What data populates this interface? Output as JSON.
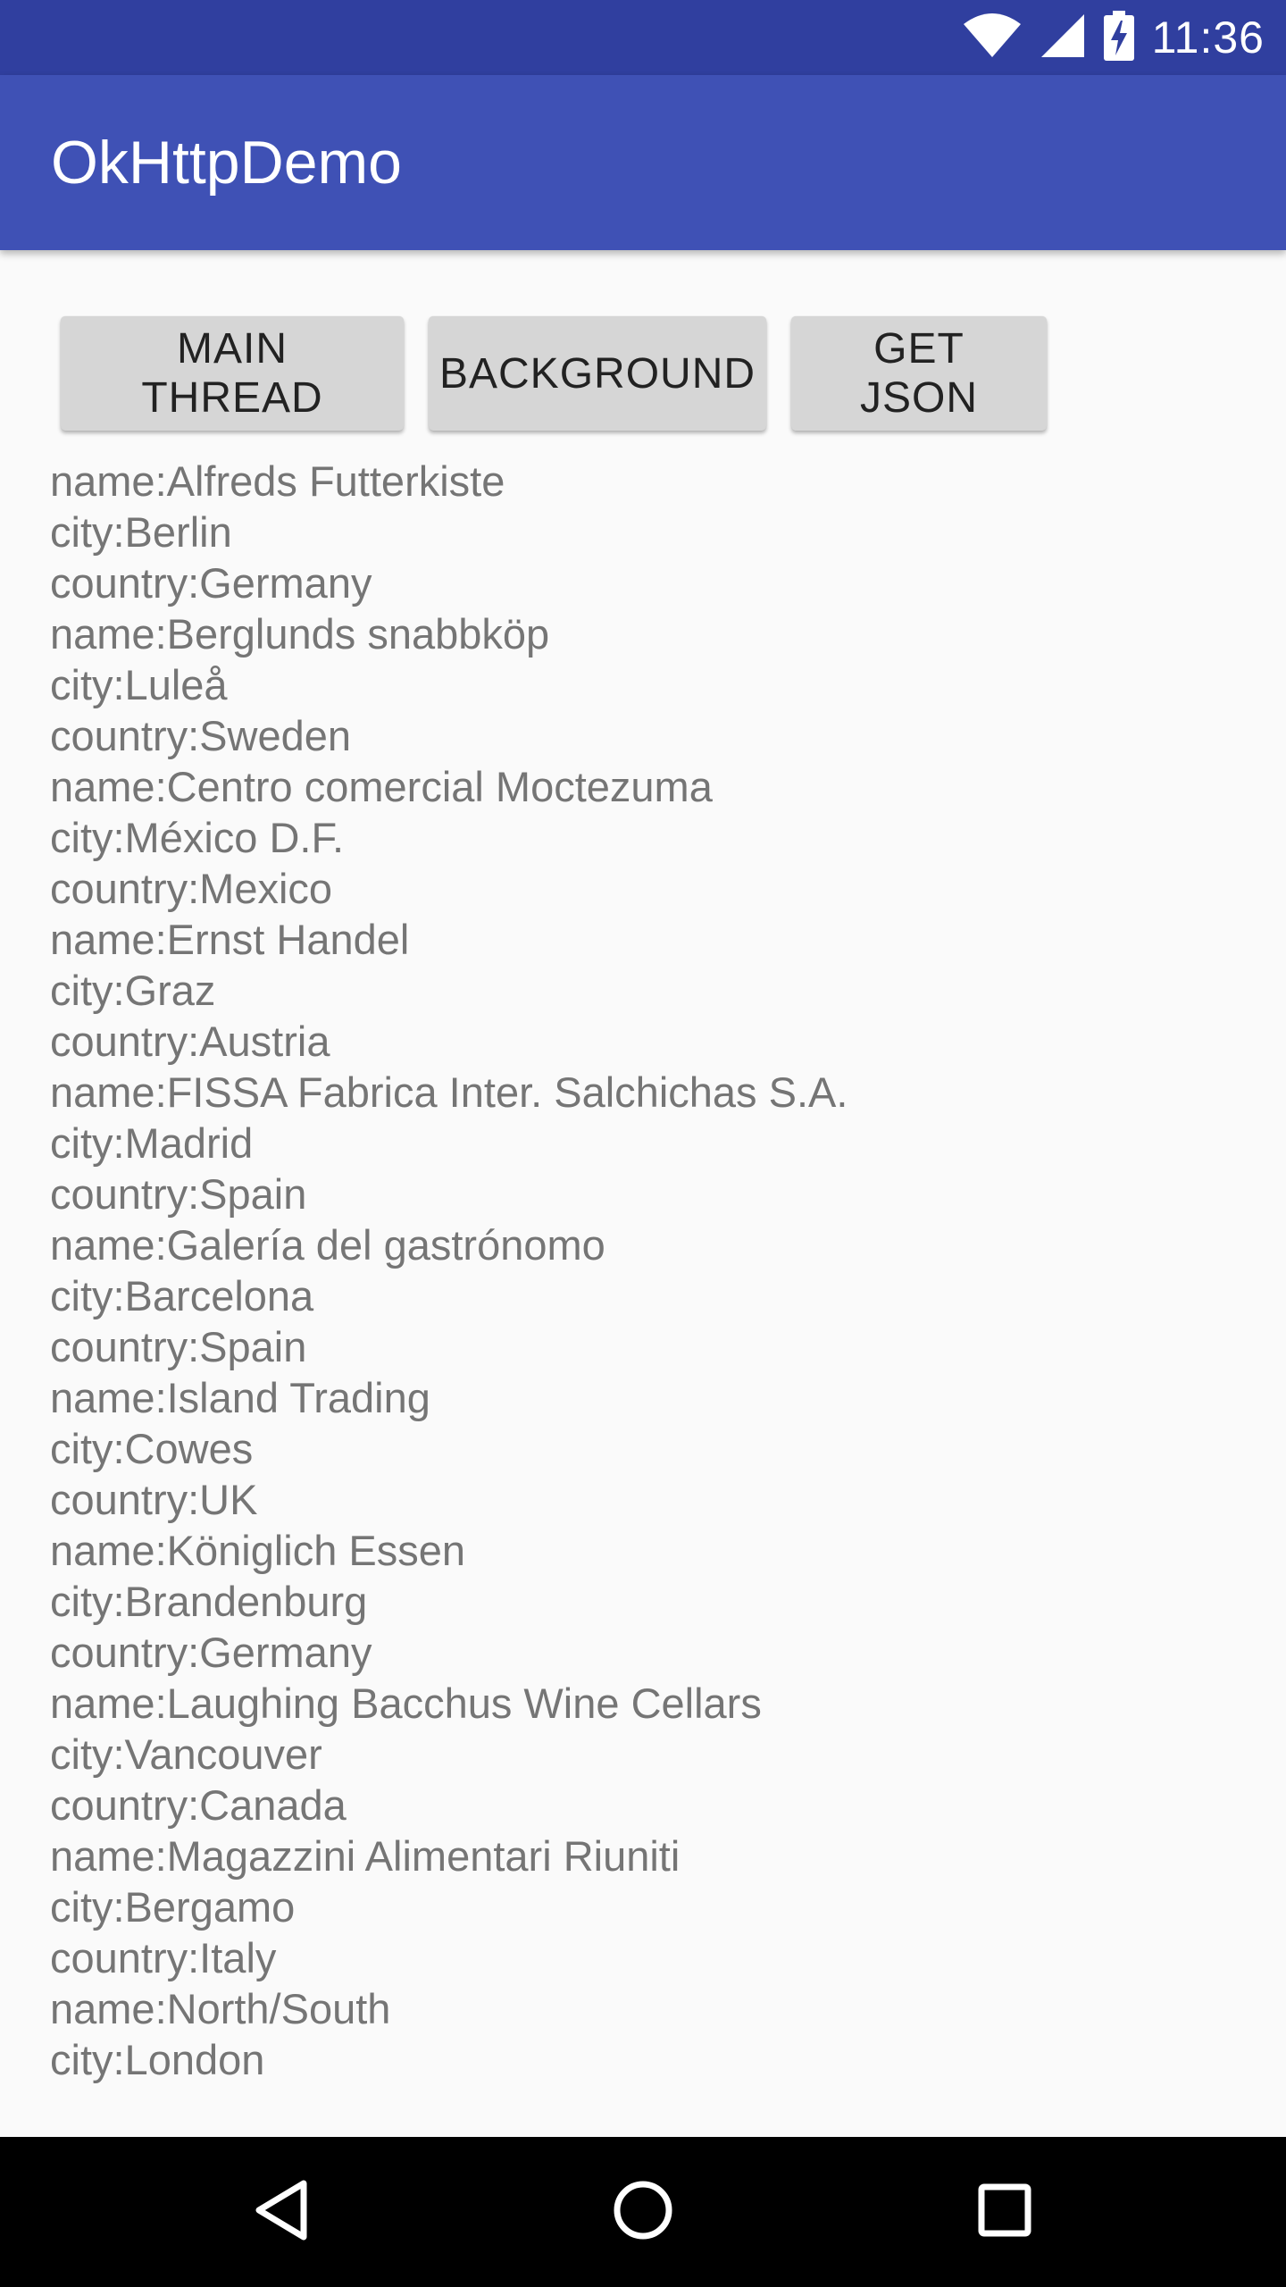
{
  "status_bar": {
    "time": "11:36",
    "icons": [
      "wifi-icon",
      "cellular-signal-icon",
      "battery-charging-icon"
    ],
    "color": "#303f9f"
  },
  "app_bar": {
    "title": "OkHttpDemo",
    "color": "#3f51b5"
  },
  "buttons": {
    "main_thread": "MAIN THREAD",
    "background": "BACKGROUND",
    "get_json": "GET JSON"
  },
  "output_lines": [
    "name:Alfreds Futterkiste",
    "city:Berlin",
    "country:Germany",
    "name:Berglunds snabbköp",
    "city:Luleå",
    "country:Sweden",
    "name:Centro comercial Moctezuma",
    "city:México D.F.",
    "country:Mexico",
    "name:Ernst Handel",
    "city:Graz",
    "country:Austria",
    "name:FISSA Fabrica Inter. Salchichas S.A.",
    "city:Madrid",
    "country:Spain",
    "name:Galería del gastrónomo",
    "city:Barcelona",
    "country:Spain",
    "name:Island Trading",
    "city:Cowes",
    "country:UK",
    "name:Königlich Essen",
    "city:Brandenburg",
    "country:Germany",
    "name:Laughing Bacchus Wine Cellars",
    "city:Vancouver",
    "country:Canada",
    "name:Magazzini Alimentari Riuniti",
    "city:Bergamo",
    "country:Italy",
    "name:North/South",
    "city:London"
  ],
  "nav_bar": {
    "icons": [
      "back-icon",
      "home-icon",
      "recent-apps-icon"
    ]
  }
}
